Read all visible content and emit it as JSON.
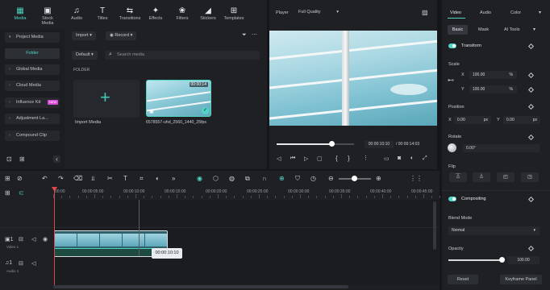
{
  "toolbar": {
    "tabs": [
      {
        "label": "Media",
        "icon": "media-icon",
        "glyph": "▦"
      },
      {
        "label": "Stock Media",
        "icon": "stock-media-icon",
        "glyph": "▣"
      },
      {
        "label": "Audio",
        "icon": "audio-icon",
        "glyph": "♫"
      },
      {
        "label": "Titles",
        "icon": "titles-icon",
        "glyph": "T"
      },
      {
        "label": "Transitions",
        "icon": "transitions-icon",
        "glyph": "⇆"
      },
      {
        "label": "Effects",
        "icon": "effects-icon",
        "glyph": "✦"
      },
      {
        "label": "Filters",
        "icon": "filters-icon",
        "glyph": "❀"
      },
      {
        "label": "Stickers",
        "icon": "stickers-icon",
        "glyph": "◢"
      },
      {
        "label": "Templates",
        "icon": "templates-icon",
        "glyph": "⊞"
      }
    ]
  },
  "sidebar": {
    "project_media": "Project Media",
    "folder": "Folder",
    "items": [
      "Global Media",
      "Cloud Media",
      "Influence Kit",
      "Adjustment La...",
      "Compound Clip"
    ],
    "new_badge": "NEW"
  },
  "media": {
    "import_label": "Import",
    "record_label": "Record",
    "sort_label": "Default",
    "search_placeholder": "Search media",
    "folder_header": "FOLDER",
    "import_tile_label": "Import Media",
    "clip_name": "6578557-uhd_2560_1440_25fps",
    "clip_duration": "00:00:14"
  },
  "player": {
    "label": "Player",
    "quality": "Full Quality",
    "current_time": "00:00:10:10",
    "total_time": "/ 00:00:14:03",
    "progress": 0.71
  },
  "timeline": {
    "ticks": [
      "00:00",
      "00:00:05:00",
      "00:00:10:00",
      "00:00:15:00",
      "00:00:20:00",
      "00:00:25:00",
      "00:00:30:00",
      "00:00:35:00",
      "00:00:40:00",
      "00:00:45:00"
    ],
    "tooltip_time": "00:00:10:10",
    "video_track": "Video 1",
    "audio_track": "Audio 1"
  },
  "right_panel": {
    "tabs": [
      "Video",
      "Audio",
      "Color"
    ],
    "subtabs": [
      "Basic",
      "Mask",
      "AI Tools"
    ],
    "transform": "Transform",
    "scale": "Scale",
    "scale_x_label": "X",
    "scale_x": "100.00",
    "scale_y_label": "Y",
    "scale_y": "100.00",
    "percent": "%",
    "position": "Position",
    "pos_x_label": "X",
    "pos_x": "0.00",
    "pos_y_label": "Y",
    "pos_y": "0.00",
    "px": "px",
    "rotate": "Rotate",
    "rotate_value": "0.00°",
    "flip": "Flip",
    "compositing": "Compositing",
    "blend_mode": "Blend Mode",
    "blend_value": "Normal",
    "opacity": "Opacity",
    "opacity_value": "100.00",
    "opacity_level": 1.0,
    "reset": "Reset",
    "keyframe_panel": "Keyframe Panel"
  },
  "colors": {
    "accent": "#4fd6c4",
    "playhead": "#e0474c",
    "badge": "#d94bd6"
  }
}
